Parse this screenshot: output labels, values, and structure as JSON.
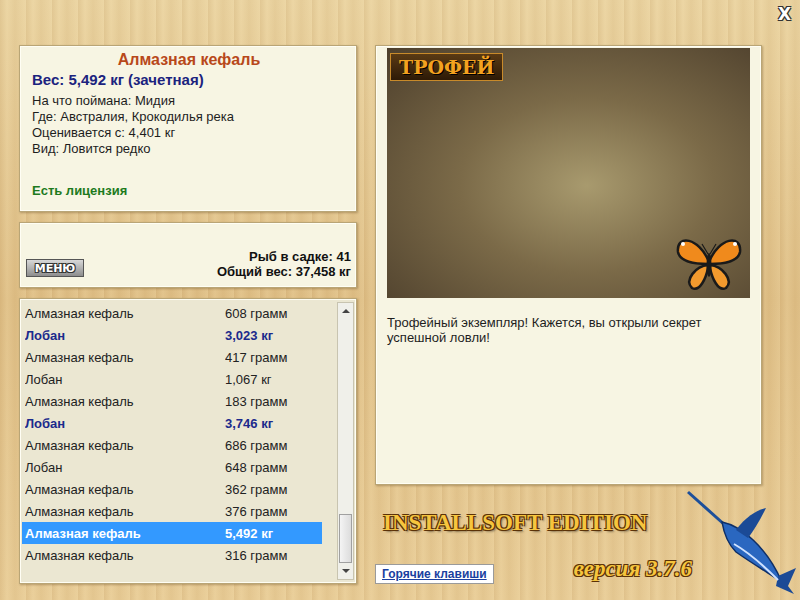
{
  "window": {
    "close": "X"
  },
  "fish_info": {
    "title": "Алмазная кефаль",
    "weight": "Вес: 5,492 кг (зачетная)",
    "details": [
      "На что поймана: Мидия",
      "Где: Австралия, Крокодилья река",
      "Оценивается с: 4,401 кг",
      "Вид: Ловится редко"
    ],
    "license": "Есть лицензия"
  },
  "keepnet": {
    "menu_button": "МЕНЮ",
    "count": "Рыб в садке: 41",
    "total": "Общий вес: 37,458 кг"
  },
  "catch_list": {
    "rows": [
      {
        "name": "Алмазная кефаль",
        "weight": "608 грамм",
        "trophy": false,
        "selected": false
      },
      {
        "name": "Лобан",
        "weight": "3,023 кг",
        "trophy": true,
        "selected": false
      },
      {
        "name": "Алмазная кефаль",
        "weight": "417 грамм",
        "trophy": false,
        "selected": false
      },
      {
        "name": "Лобан",
        "weight": "1,067 кг",
        "trophy": false,
        "selected": false
      },
      {
        "name": "Алмазная кефаль",
        "weight": "183 грамм",
        "trophy": false,
        "selected": false
      },
      {
        "name": "Лобан",
        "weight": "3,746 кг",
        "trophy": true,
        "selected": false
      },
      {
        "name": "Алмазная кефаль",
        "weight": "686 грамм",
        "trophy": false,
        "selected": false
      },
      {
        "name": "Лобан",
        "weight": "648 грамм",
        "trophy": false,
        "selected": false
      },
      {
        "name": "Алмазная кефаль",
        "weight": "362 грамм",
        "trophy": false,
        "selected": false
      },
      {
        "name": "Алмазная кефаль",
        "weight": "376 грамм",
        "trophy": false,
        "selected": false
      },
      {
        "name": "Алмазная кефаль",
        "weight": "5,492 кг",
        "trophy": true,
        "selected": true
      },
      {
        "name": "Алмазная кефаль",
        "weight": "316 грамм",
        "trophy": false,
        "selected": false
      }
    ],
    "scrollbar": {
      "position": 1,
      "thumb_share": 0.2
    }
  },
  "photo": {
    "badge": "ТРОФЕЙ"
  },
  "description": "Трофейный экземпляр! Кажется, вы открыли секрет успешной ловли!",
  "logo": {
    "title": "INSTALLSOFT EDITION",
    "version": "версия 3.7.6"
  },
  "hotkeys_button": "Горячие клавиши"
}
